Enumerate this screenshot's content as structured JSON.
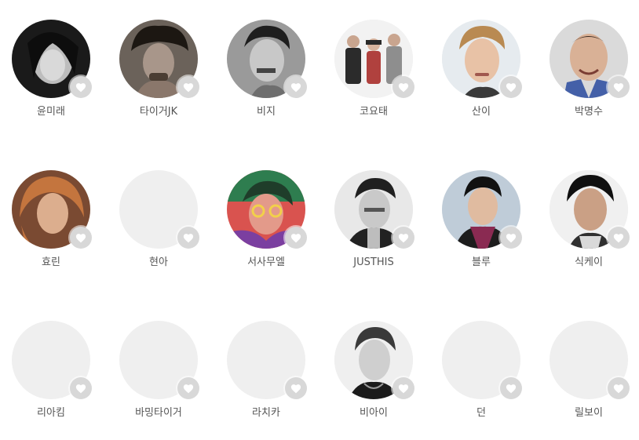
{
  "artists": [
    {
      "name": "윤미래"
    },
    {
      "name": "타이거JK"
    },
    {
      "name": "비지"
    },
    {
      "name": "코요태"
    },
    {
      "name": "산이"
    },
    {
      "name": "박명수"
    },
    {
      "name": "효린"
    },
    {
      "name": "현아"
    },
    {
      "name": "서사무엘"
    },
    {
      "name": "JUSTHIS"
    },
    {
      "name": "블루"
    },
    {
      "name": "식케이"
    },
    {
      "name": "리아킴"
    },
    {
      "name": "바밍타이거"
    },
    {
      "name": "라치카"
    },
    {
      "name": "비아이"
    },
    {
      "name": "던"
    },
    {
      "name": "릴보이"
    }
  ],
  "icons": {
    "like": "heart-icon"
  },
  "colors": {
    "placeholder": "#efefef",
    "like_button": "#d8d8d8",
    "name_text": "#555555"
  }
}
